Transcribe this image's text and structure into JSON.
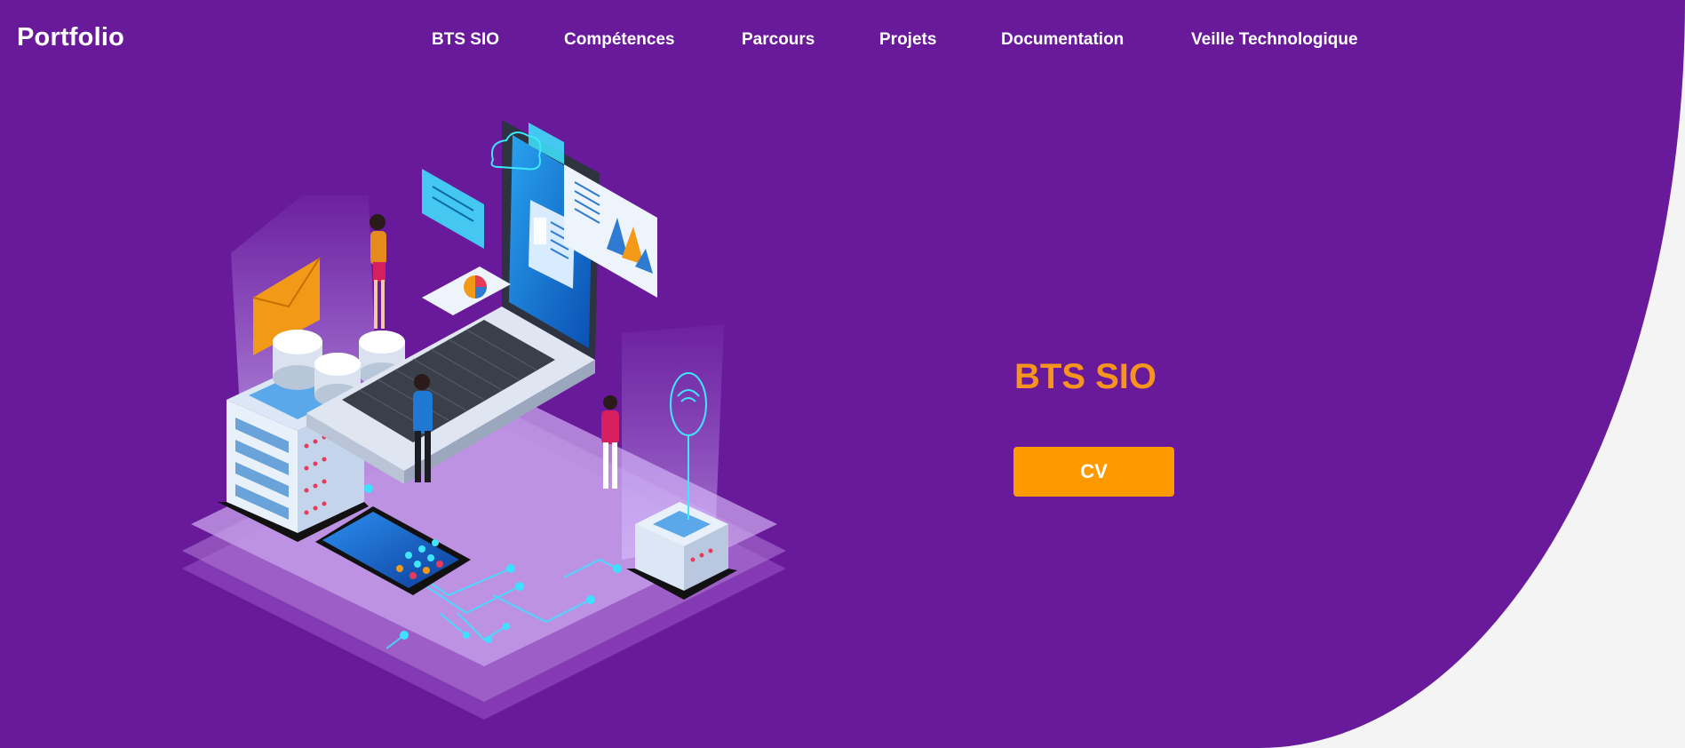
{
  "navbar": {
    "brand": "Portfolio",
    "links": [
      {
        "label": "BTS SIO"
      },
      {
        "label": "Compétences"
      },
      {
        "label": "Parcours"
      },
      {
        "label": "Projets"
      },
      {
        "label": "Documentation"
      },
      {
        "label": "Veille Technologique"
      }
    ]
  },
  "hero": {
    "title": "BTS SIO",
    "cv_button": "CV"
  },
  "colors": {
    "background": "#681a9a",
    "accent": "#ff9900",
    "title": "#f7941d",
    "text": "#ffffff",
    "page_corner": "#f4f4f4"
  },
  "illustration": {
    "icon": "isometric-tech-workspace-illustration"
  }
}
